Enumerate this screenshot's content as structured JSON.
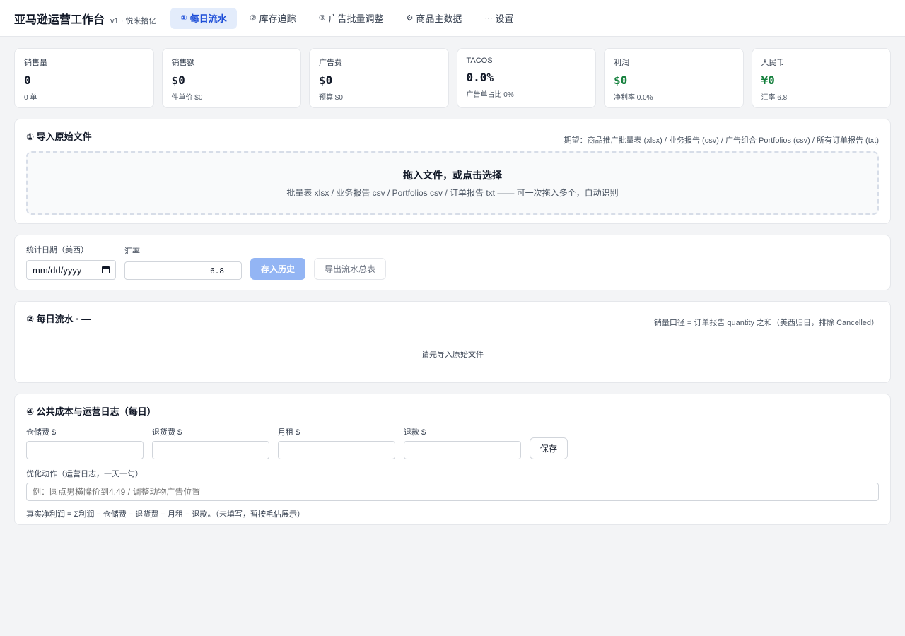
{
  "header": {
    "title": "亚马逊运营工作台",
    "subtitle": "v1 · 悦来拾亿",
    "tabs": [
      {
        "icon": "①",
        "label": "每日流水"
      },
      {
        "icon": "②",
        "label": "库存追踪"
      },
      {
        "icon": "③",
        "label": "广告批量调整"
      },
      {
        "icon": "⚙",
        "label": "商品主数据"
      },
      {
        "icon": "⋯",
        "label": "设置"
      }
    ]
  },
  "stats": [
    {
      "label": "销售量",
      "value": "0",
      "sub": "0 单"
    },
    {
      "label": "销售额",
      "value": "$0",
      "sub": "件单价 $0"
    },
    {
      "label": "广告费",
      "value": "$0",
      "sub": "预算 $0"
    },
    {
      "label": "TACOS",
      "value": "0.0%",
      "sub": "广告单占比 0%"
    },
    {
      "label": "利润",
      "value": "$0",
      "sub": "净利率 0.0%"
    },
    {
      "label": "人民币",
      "value": "¥0",
      "sub": "汇率 6.8"
    }
  ],
  "import": {
    "title": "① 导入原始文件",
    "note": "期望：商品推广批量表 (xlsx) / 业务报告 (csv) / 广告组合 Portfolios (csv) / 所有订单报告 (txt)",
    "drop_title": "拖入文件，或点击选择",
    "drop_sub": "批量表 xlsx / 业务报告 csv / Portfolios csv / 订单报告 txt —— 可一次拖入多个，自动识别"
  },
  "controls": {
    "date_label": "统计日期（美西）",
    "date_placeholder": "mm/dd/yyyy",
    "rate_label": "汇率",
    "rate_value": "6.8",
    "save_history": "存入历史",
    "export": "导出流水总表"
  },
  "flow": {
    "title": "② 每日流水 · —",
    "note": "销量口径 = 订单报告 quantity 之和（美西归日，排除 Cancelled）",
    "empty": "请先导入原始文件"
  },
  "costs": {
    "title": "④ 公共成本与运营日志（每日）",
    "storage_label": "仓储费 $",
    "return_label": "退货费 $",
    "rent_label": "月租 $",
    "refund_label": "退款 $",
    "save": "保存",
    "log_label": "优化动作（运营日志，一天一句）",
    "log_placeholder": "例：圆点男横降价到4.49 / 调整动物广告位置",
    "formula": "真实净利润 = Σ利润 − 仓储费 − 退货费 − 月租 − 退款。（未填写，暂按毛估展示）"
  },
  "colors": {
    "accent": "#1d4ed8",
    "profit": "#15803d",
    "primary_btn": "#93b5f4"
  }
}
